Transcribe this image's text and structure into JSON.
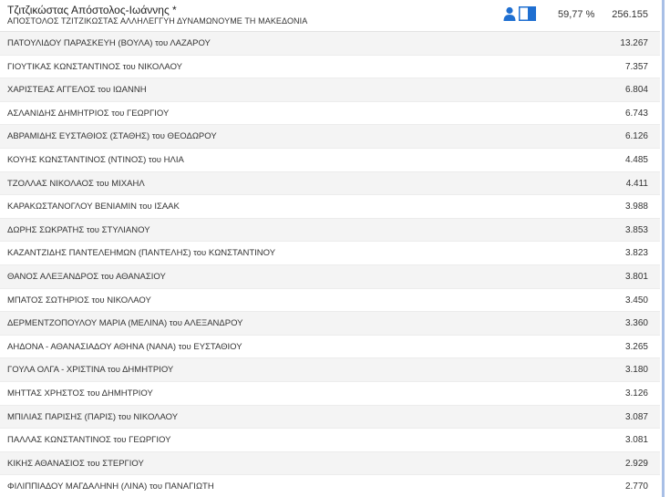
{
  "header": {
    "name": "Τζιτζικώστας Απόστολος-Ιωάννης *",
    "party": "ΑΠΟΣΤΟΛΟΣ ΤΖΙΤΖΙΚΩΣΤΑΣ ΑΛΛΗΛΕΓΓΥΗ ΔΥΝΑΜΩΝΟΥΜΕ ΤΗ ΜΑΚΕΔΟΝΙΑ",
    "percent": "59,77 %",
    "votes": "256.155",
    "icons": [
      "person-icon",
      "split-square-icon"
    ],
    "accent": "#1f6fd1"
  },
  "candidates": [
    {
      "name": "ΠΑΤΟΥΛΙΔΟΥ ΠΑΡΑΣΚΕΥΗ (ΒΟΥΛΑ) του ΛΑΖΑΡΟΥ",
      "votes": "13.267"
    },
    {
      "name": "ΓΙΟΥΤΙΚΑΣ ΚΩΝΣΤΑΝΤΙΝΟΣ του ΝΙΚΟΛΑΟΥ",
      "votes": "7.357"
    },
    {
      "name": "ΧΑΡΙΣΤΕΑΣ ΑΓΓΕΛΟΣ του ΙΩΑΝΝΗ",
      "votes": "6.804"
    },
    {
      "name": "ΑΣΛΑΝΙΔΗΣ ΔΗΜΗΤΡΙΟΣ του ΓΕΩΡΓΙΟΥ",
      "votes": "6.743"
    },
    {
      "name": "ΑΒΡΑΜΙΔΗΣ ΕΥΣΤΑΘΙΟΣ (ΣΤΑΘΗΣ) του ΘΕΟΔΩΡΟΥ",
      "votes": "6.126"
    },
    {
      "name": "ΚΟΥΗΣ ΚΩΝΣΤΑΝΤΙΝΟΣ (ΝΤΙΝΟΣ) του ΗΛΙΑ",
      "votes": "4.485"
    },
    {
      "name": "ΤΖΟΛΛΑΣ ΝΙΚΟΛΑΟΣ του ΜΙΧΑΗΛ",
      "votes": "4.411"
    },
    {
      "name": "ΚΑΡΑΚΩΣΤΑΝΟΓΛΟΥ ΒΕΝΙΑΜΙΝ του ΙΣΑΑΚ",
      "votes": "3.988"
    },
    {
      "name": "ΔΩΡΗΣ ΣΩΚΡΑΤΗΣ του ΣΤΥΛΙΑΝΟΥ",
      "votes": "3.853"
    },
    {
      "name": "ΚΑΖΑΝΤΖΙΔΗΣ ΠΑΝΤΕΛΕΗΜΩΝ (ΠΑΝΤΕΛΗΣ) του ΚΩΝΣΤΑΝΤΙΝΟΥ",
      "votes": "3.823"
    },
    {
      "name": "ΘΑΝΟΣ ΑΛΕΞΑΝΔΡΟΣ του ΑΘΑΝΑΣΙΟΥ",
      "votes": "3.801"
    },
    {
      "name": "ΜΠΑΤΟΣ ΣΩΤΗΡΙΟΣ του ΝΙΚΟΛΑΟΥ",
      "votes": "3.450"
    },
    {
      "name": "ΔΕΡΜΕΝΤΖΟΠΟΥΛΟΥ ΜΑΡΙΑ (ΜΕΛΙΝΑ) του ΑΛΕΞΑΝΔΡΟΥ",
      "votes": "3.360"
    },
    {
      "name": "ΑΗΔΟΝΑ - ΑΘΑΝΑΣΙΑΔΟΥ ΑΘΗΝΑ (ΝΑΝΑ) του ΕΥΣΤΑΘΙΟΥ",
      "votes": "3.265"
    },
    {
      "name": "ΓΟΥΛΑ ΟΛΓΑ - ΧΡΙΣΤΙΝΑ του ΔΗΜΗΤΡΙΟΥ",
      "votes": "3.180"
    },
    {
      "name": "ΜΗΤΤΑΣ ΧΡΗΣΤΟΣ του ΔΗΜΗΤΡΙΟΥ",
      "votes": "3.126"
    },
    {
      "name": "ΜΠΙΛΙΑΣ ΠΑΡΙΣΗΣ (ΠΑΡΙΣ) του ΝΙΚΟΛΑΟΥ",
      "votes": "3.087"
    },
    {
      "name": "ΠΑΛΛΑΣ ΚΩΝΣΤΑΝΤΙΝΟΣ του ΓΕΩΡΓΙΟΥ",
      "votes": "3.081"
    },
    {
      "name": "ΚΙΚΗΣ ΑΘΑΝΑΣΙΟΣ του ΣΤΕΡΓΙΟΥ",
      "votes": "2.929"
    },
    {
      "name": "ΦΙΛΙΠΠΙΑΔΟΥ ΜΑΓΔΑΛΗΝΗ (ΛΙΝΑ) του ΠΑΝΑΓΙΩΤΗ",
      "votes": "2.770"
    }
  ]
}
